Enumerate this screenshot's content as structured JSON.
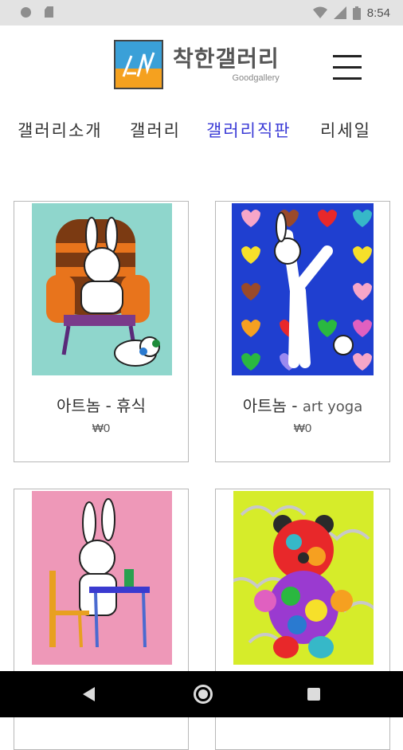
{
  "status_bar": {
    "time": "8:54"
  },
  "header": {
    "logo_kr": "착한갤러리",
    "logo_en": "Goodgallery"
  },
  "nav": {
    "items": [
      {
        "label": "갤러리소개"
      },
      {
        "label": "갤러리"
      },
      {
        "label": "갤러리직판"
      },
      {
        "label": "리세일"
      }
    ],
    "active_index": 2
  },
  "products": [
    {
      "title_kr": "아트놈 - 휴식",
      "title_en": "",
      "price": "₩0",
      "image": "bunny-in-armchair-artwork"
    },
    {
      "title_kr": "아트놈 - ",
      "title_en": "art yoga",
      "price": "₩0",
      "image": "bunny-yoga-hearts-artwork"
    },
    {
      "title_kr": "",
      "title_en": "",
      "price": "",
      "image": "bunny-at-desk-artwork"
    },
    {
      "title_kr": "",
      "title_en": "",
      "price": "",
      "image": "heart-bear-artwork"
    }
  ],
  "colors": {
    "nav_active": "#3a3ad6",
    "status_bg": "#e3e3e3"
  }
}
